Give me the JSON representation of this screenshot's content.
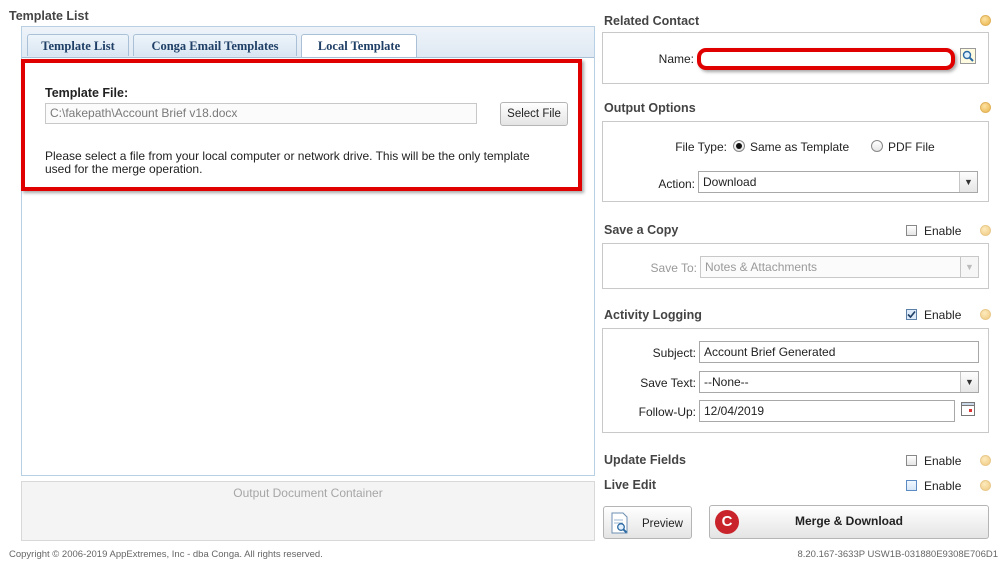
{
  "left": {
    "section_title": "Template List",
    "tabs": [
      "Template List",
      "Conga Email Templates",
      "Local Template"
    ],
    "template_file_label": "Template File:",
    "template_file_value": "C:\\fakepath\\Account Brief v18.docx",
    "select_file_label": "Select File",
    "help_text": "Please select a file from your local computer or network drive. This will be the only template used for the merge operation.",
    "output_container_label": "Output Document Container"
  },
  "related_contact": {
    "title": "Related Contact",
    "name_label": "Name:",
    "name_value": ""
  },
  "output_options": {
    "title": "Output Options",
    "file_type_label": "File Type:",
    "file_type_options": [
      "Same as Template",
      "PDF File"
    ],
    "file_type_selected": "Same as Template",
    "action_label": "Action:",
    "action_value": "Download"
  },
  "save_copy": {
    "title": "Save a Copy",
    "enable_label": "Enable",
    "enabled": false,
    "save_to_label": "Save To:",
    "save_to_value": "Notes & Attachments"
  },
  "activity_logging": {
    "title": "Activity Logging",
    "enable_label": "Enable",
    "enabled": true,
    "subject_label": "Subject:",
    "subject_value": "Account Brief Generated",
    "save_text_label": "Save Text:",
    "save_text_value": "--None--",
    "follow_up_label": "Follow-Up:",
    "follow_up_value": "12/04/2019"
  },
  "update_fields": {
    "title": "Update Fields",
    "enable_label": "Enable",
    "enabled": false
  },
  "live_edit": {
    "title": "Live Edit",
    "enable_label": "Enable",
    "enabled": false
  },
  "buttons": {
    "preview": "Preview",
    "merge": "Merge & Download"
  },
  "footer": {
    "copyright": "Copyright © 2006-2019 AppExtremes, Inc - dba Conga. All rights reserved.",
    "version": "8.20.167-3633P USW1B-031880E9308E706D1"
  },
  "colors": {
    "highlight": "#e00000",
    "merge_icon": "#c9242b"
  }
}
